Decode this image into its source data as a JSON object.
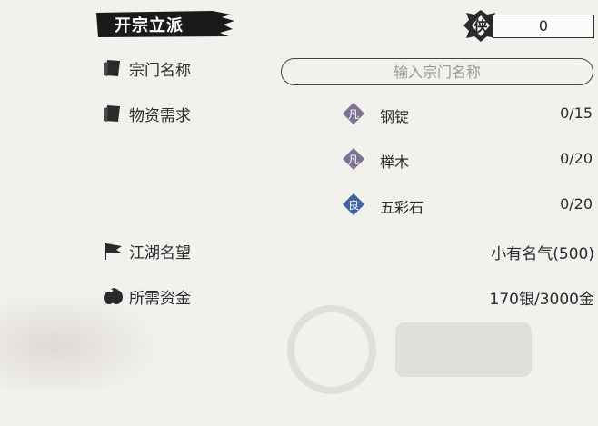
{
  "title": "开宗立派",
  "xia_icon_char": "侠",
  "counter_value": "0",
  "sect_name": {
    "label": "宗门名称",
    "placeholder": "输入宗门名称",
    "icon": "scroll-icon"
  },
  "materials": {
    "label": "物资需求",
    "icon": "scroll-icon",
    "items": [
      {
        "grade": "凡",
        "grade_color": "#7b7391",
        "name": "钢锭",
        "count": "0/15"
      },
      {
        "grade": "凡",
        "grade_color": "#7b7391",
        "name": "榉木",
        "count": "0/20"
      },
      {
        "grade": "良",
        "grade_color": "#3f64a3",
        "name": "五彩石",
        "count": "0/20"
      }
    ]
  },
  "reputation": {
    "label": "江湖名望",
    "value": "小有名气(500)",
    "icon": "flag-icon"
  },
  "funds": {
    "label": "所需资金",
    "value": "170银/3000金",
    "icon": "money-bag-icon"
  },
  "colors": {
    "banner": "#1a1a1a",
    "background": "#f3f1ee",
    "text": "#2b2b2b"
  }
}
